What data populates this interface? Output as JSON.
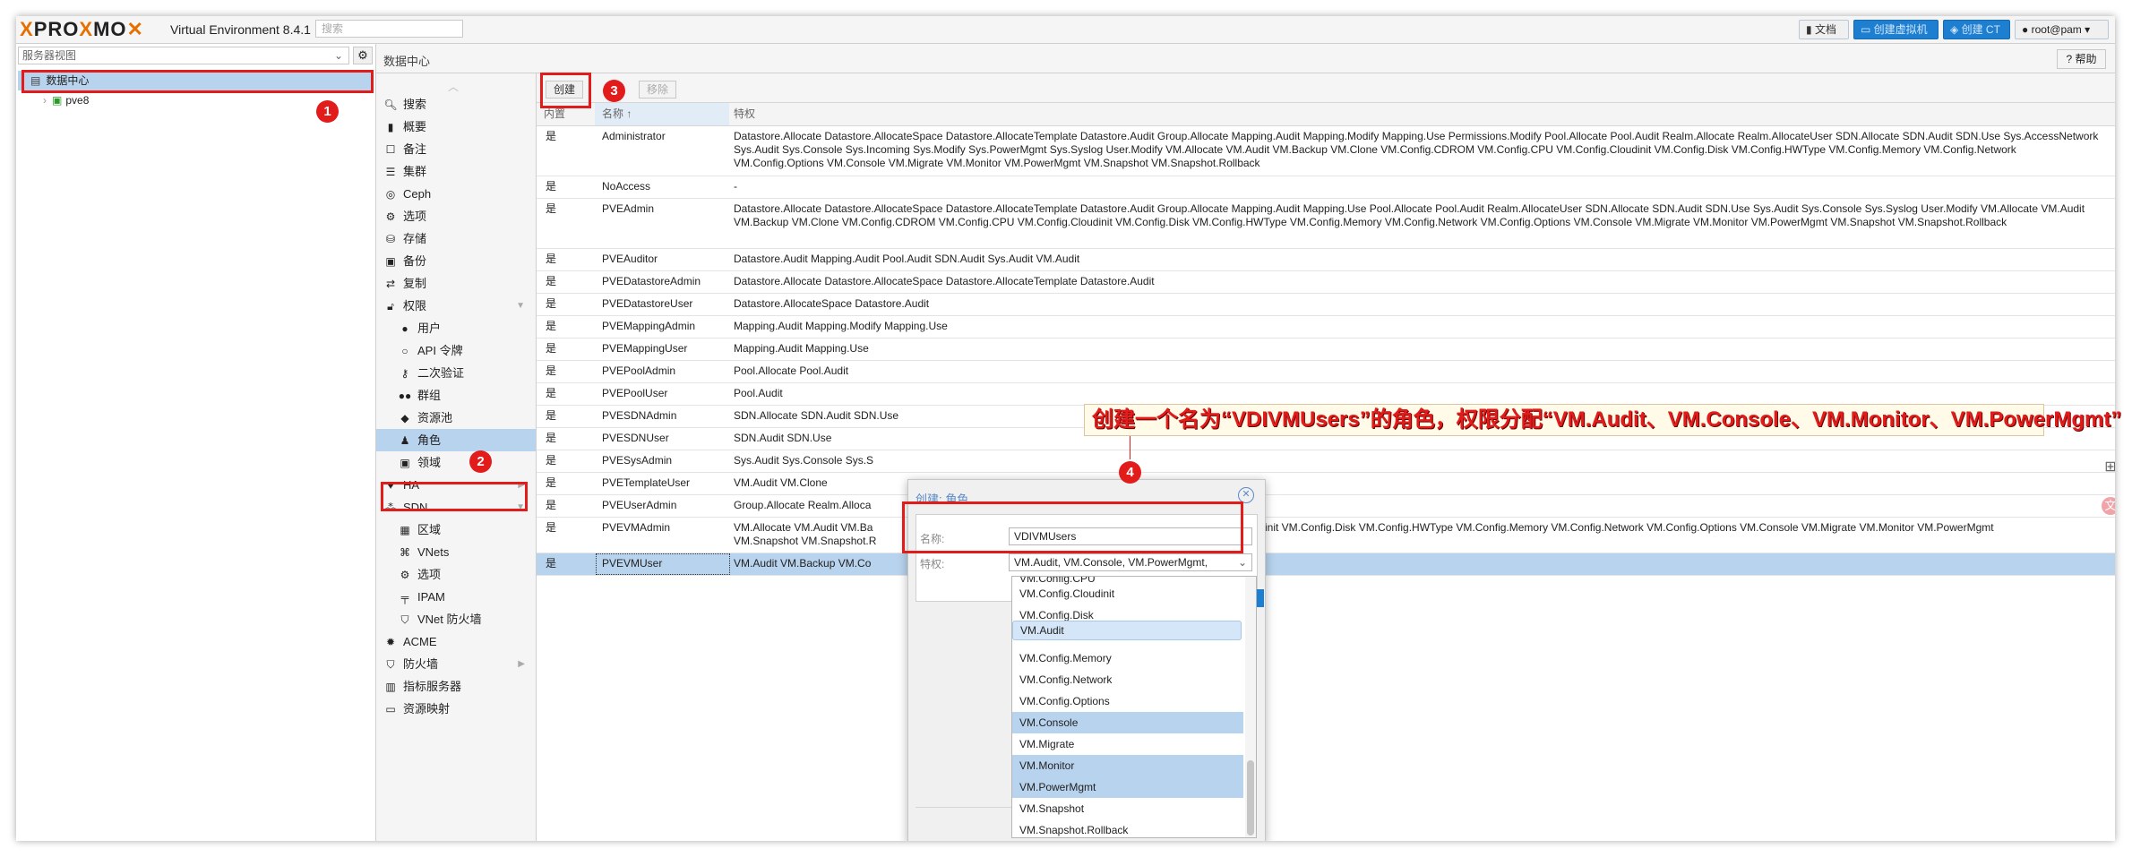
{
  "header": {
    "logo_pre": "PRO",
    "logo_x": "X",
    "logo_mo": "MO",
    "logo_x2": "X",
    "version": "Virtual Environment 8.4.1",
    "search_placeholder": "搜索",
    "docs_label": "文档",
    "create_vm_label": "创建虚拟机",
    "create_ct_label": "创建 CT",
    "user_label": "root@pam"
  },
  "tree": {
    "view_select": "服务器视图",
    "datacenter": "数据中心",
    "node": "pve8"
  },
  "content_header": {
    "title": "数据中心",
    "help_label": "帮助"
  },
  "nav": {
    "items": [
      {
        "label": "搜索",
        "icon": "search-icon"
      },
      {
        "label": "概要",
        "icon": "book-icon"
      },
      {
        "label": "备注",
        "icon": "note-icon"
      },
      {
        "label": "集群",
        "icon": "server-icon"
      },
      {
        "label": "Ceph",
        "icon": "ceph-icon"
      },
      {
        "label": "选项",
        "icon": "gear-icon"
      },
      {
        "label": "存储",
        "icon": "database-icon"
      },
      {
        "label": "备份",
        "icon": "floppy-icon"
      },
      {
        "label": "复制",
        "icon": "retweet-icon"
      },
      {
        "label": "权限",
        "icon": "unlock-icon"
      },
      {
        "label": "用户",
        "icon": "user-icon"
      },
      {
        "label": "API 令牌",
        "icon": "user-outline-icon"
      },
      {
        "label": "二次验证",
        "icon": "key-icon"
      },
      {
        "label": "群组",
        "icon": "users-icon"
      },
      {
        "label": "资源池",
        "icon": "tags-icon"
      },
      {
        "label": "角色",
        "icon": "male-icon"
      },
      {
        "label": "领域",
        "icon": "address-book-icon"
      },
      {
        "label": "HA",
        "icon": "heartbeat-icon"
      },
      {
        "label": "SDN",
        "icon": "sdn-icon"
      },
      {
        "label": "区域",
        "icon": "th-icon"
      },
      {
        "label": "VNets",
        "icon": "sitemap-icon"
      },
      {
        "label": "选项",
        "icon": "gear-icon"
      },
      {
        "label": "IPAM",
        "icon": "ipam-icon"
      },
      {
        "label": "VNet 防火墙",
        "icon": "shield-icon"
      },
      {
        "label": "ACME",
        "icon": "certificate-icon"
      },
      {
        "label": "防火墙",
        "icon": "shield-icon"
      },
      {
        "label": "指标服务器",
        "icon": "chart-icon"
      },
      {
        "label": "资源映射",
        "icon": "folder-icon"
      }
    ]
  },
  "toolbar": {
    "create_label": "创建",
    "remove_label": "移除"
  },
  "table": {
    "headers": [
      "内置",
      "名称 ↑",
      "特权"
    ],
    "rows": [
      {
        "builtin": "是",
        "name": "Administrator",
        "privs": "Datastore.Allocate Datastore.AllocateSpace Datastore.AllocateTemplate Datastore.Audit Group.Allocate Mapping.Audit Mapping.Modify Mapping.Use Permissions.Modify Pool.Allocate Pool.Audit Realm.Allocate Realm.AllocateUser SDN.Allocate SDN.Audit SDN.Use Sys.AccessNetwork Sys.Audit Sys.Console Sys.Incoming Sys.Modify Sys.PowerMgmt Sys.Syslog User.Modify VM.Allocate VM.Audit VM.Backup VM.Clone VM.Config.CDROM VM.Config.CPU VM.Config.Cloudinit VM.Config.Disk VM.Config.HWType VM.Config.Memory VM.Config.Network VM.Config.Options VM.Console VM.Migrate VM.Monitor VM.PowerMgmt VM.Snapshot VM.Snapshot.Rollback"
      },
      {
        "builtin": "是",
        "name": "NoAccess",
        "privs": "-"
      },
      {
        "builtin": "是",
        "name": "PVEAdmin",
        "privs": "Datastore.Allocate Datastore.AllocateSpace Datastore.AllocateTemplate Datastore.Audit Group.Allocate Mapping.Audit Mapping.Use Pool.Allocate Pool.Audit Realm.AllocateUser SDN.Allocate SDN.Audit SDN.Use Sys.Audit Sys.Console Sys.Syslog User.Modify VM.Allocate VM.Audit VM.Backup VM.Clone VM.Config.CDROM VM.Config.CPU VM.Config.Cloudinit VM.Config.Disk VM.Config.HWType VM.Config.Memory VM.Config.Network VM.Config.Options VM.Console VM.Migrate VM.Monitor VM.PowerMgmt VM.Snapshot VM.Snapshot.Rollback"
      },
      {
        "builtin": "是",
        "name": "PVEAuditor",
        "privs": "Datastore.Audit Mapping.Audit Pool.Audit SDN.Audit Sys.Audit VM.Audit"
      },
      {
        "builtin": "是",
        "name": "PVEDatastoreAdmin",
        "privs": "Datastore.Allocate Datastore.AllocateSpace Datastore.AllocateTemplate Datastore.Audit"
      },
      {
        "builtin": "是",
        "name": "PVEDatastoreUser",
        "privs": "Datastore.AllocateSpace Datastore.Audit"
      },
      {
        "builtin": "是",
        "name": "PVEMappingAdmin",
        "privs": "Mapping.Audit Mapping.Modify Mapping.Use"
      },
      {
        "builtin": "是",
        "name": "PVEMappingUser",
        "privs": "Mapping.Audit Mapping.Use"
      },
      {
        "builtin": "是",
        "name": "PVEPoolAdmin",
        "privs": "Pool.Allocate Pool.Audit"
      },
      {
        "builtin": "是",
        "name": "PVEPoolUser",
        "privs": "Pool.Audit"
      },
      {
        "builtin": "是",
        "name": "PVESDNAdmin",
        "privs": "SDN.Allocate SDN.Audit SDN.Use"
      },
      {
        "builtin": "是",
        "name": "PVESDNUser",
        "privs": "SDN.Audit SDN.Use"
      },
      {
        "builtin": "是",
        "name": "PVESysAdmin",
        "privs": "Sys.Audit Sys.Console Sys.S"
      },
      {
        "builtin": "是",
        "name": "PVETemplateUser",
        "privs": "VM.Audit VM.Clone"
      },
      {
        "builtin": "是",
        "name": "PVEUserAdmin",
        "privs": "Group.Allocate Realm.Alloca"
      },
      {
        "builtin": "是",
        "name": "PVEVMAdmin",
        "privs": "VM.Allocate VM.Audit VM.Ba"
      },
      {
        "builtin": "是",
        "name": "PVEVMUser",
        "privs": "VM.Audit VM.Backup VM.Co"
      }
    ],
    "pvevmadmin_tail": "init VM.Config.Disk VM.Config.HWType VM.Config.Memory VM.Config.Network VM.Config.Options VM.Console VM.Migrate VM.Monitor VM.PowerMgmt",
    "pvevmadmin_line2": "VM.Snapshot VM.Snapshot.R"
  },
  "dialog": {
    "title": "创建: 角色",
    "name_label": "名称:",
    "name_value": "VDIVMUsers",
    "privs_label": "特权:",
    "privs_value": "VM.Audit, VM.Console, VM.PowerMgmt,",
    "options": [
      {
        "label": "VM.Config.CPU",
        "selected": false
      },
      {
        "label": "VM.Config.Cloudinit",
        "selected": false
      },
      {
        "label": "VM.Config.Disk",
        "selected": false
      },
      {
        "label": "VM.Audit",
        "selected": true
      },
      {
        "label": "VM.Config.Memory",
        "selected": false
      },
      {
        "label": "VM.Config.Network",
        "selected": false
      },
      {
        "label": "VM.Config.Options",
        "selected": false
      },
      {
        "label": "VM.Console",
        "selected": true
      },
      {
        "label": "VM.Migrate",
        "selected": false
      },
      {
        "label": "VM.Monitor",
        "selected": true
      },
      {
        "label": "VM.PowerMgmt",
        "selected": true
      },
      {
        "label": "VM.Snapshot",
        "selected": false
      },
      {
        "label": "VM.Snapshot.Rollback",
        "selected": false
      }
    ]
  },
  "annotations": {
    "callout": "创建一个名为“VDIVMUsers”的角色，权限分配“VM.Audit、VM.Console、VM.Monitor、VM.PowerMgmt”",
    "badges": [
      "1",
      "2",
      "3",
      "4"
    ],
    "accent": "#e21b1b"
  }
}
